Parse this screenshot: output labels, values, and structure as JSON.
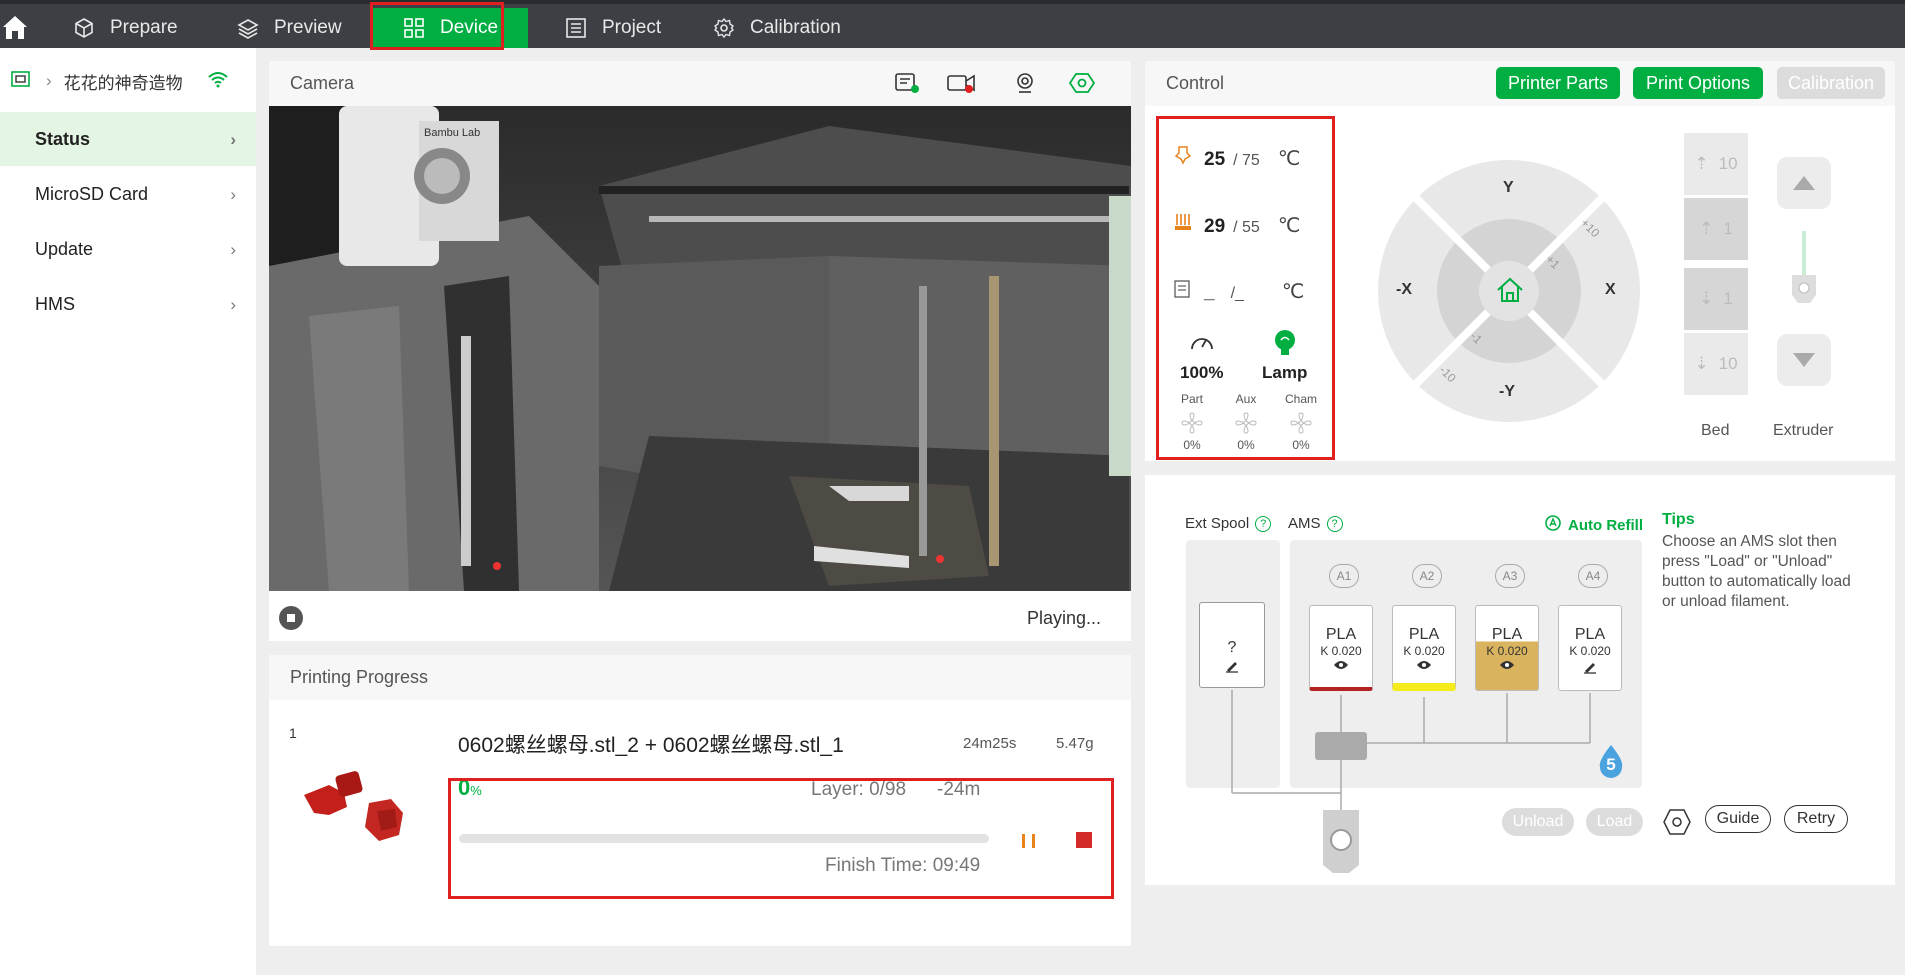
{
  "nav": {
    "tabs": [
      {
        "label": "Prepare",
        "icon": "cube-icon"
      },
      {
        "label": "Preview",
        "icon": "layers-icon"
      },
      {
        "label": "Device",
        "icon": "device-icon"
      },
      {
        "label": "Project",
        "icon": "list-icon"
      },
      {
        "label": "Calibration",
        "icon": "gear-icon"
      }
    ],
    "active_tab": "Device",
    "accent": "#00ae42"
  },
  "sidebar": {
    "device_name": "花花的神奇造物",
    "items": [
      {
        "label": "Status",
        "active": true
      },
      {
        "label": "MicroSD Card"
      },
      {
        "label": "Update"
      },
      {
        "label": "HMS"
      }
    ]
  },
  "camera": {
    "title": "Camera",
    "status": "Playing...",
    "logo": "Bambu Lab"
  },
  "progress": {
    "title": "Printing Progress",
    "plate": "1",
    "file_name": "0602螺丝螺母.stl_2 + 0602螺丝螺母.stl_1",
    "time": "24m25s",
    "weight": "5.47g",
    "percent": "0",
    "percent_unit": "%",
    "percent_value": 0,
    "layer": "Layer: 0/98",
    "remaining": "-24m",
    "finish_time": "Finish Time: 09:49"
  },
  "control": {
    "title": "Control",
    "buttons": {
      "printer_parts": "Printer Parts",
      "print_options": "Print Options",
      "calibration": "Calibration"
    },
    "nozzle": {
      "current": "25",
      "target": "/ 75",
      "unit": "℃"
    },
    "bed": {
      "current": "29",
      "target": "/ 55",
      "unit": "℃"
    },
    "chamber": {
      "current": "_",
      "target": "/_",
      "unit": "℃"
    },
    "speed": "100%",
    "lamp": "Lamp",
    "fans": [
      {
        "label": "Part",
        "value": "0%"
      },
      {
        "label": "Aux",
        "value": "0%"
      },
      {
        "label": "Cham",
        "value": "0%"
      }
    ],
    "jog": {
      "y": "Y",
      "neg_y": "-Y",
      "x": "X",
      "neg_x": "-X",
      "p10": "+10",
      "p1": "+1",
      "m1": "-1",
      "m10": "-10"
    },
    "bed_steps": [
      "10",
      "1",
      "1",
      "10"
    ],
    "bed_label": "Bed",
    "extruder_label": "Extruder"
  },
  "ams": {
    "ext_spool": "Ext Spool",
    "ams_label": "AMS",
    "auto_refill": "Auto Refill",
    "ext_slot": "?",
    "slots": [
      {
        "id": "A1",
        "material": "PLA",
        "k": "K 0.020",
        "color": "#b22222",
        "fill": "none"
      },
      {
        "id": "A2",
        "material": "PLA",
        "k": "K 0.020",
        "color": "#f5eb1b",
        "fill": "none"
      },
      {
        "id": "A3",
        "material": "PLA",
        "k": "K 0.020",
        "color": "#d9b35e",
        "fill": "#d9b35e"
      },
      {
        "id": "A4",
        "material": "PLA",
        "k": "K 0.020",
        "color": "#ffffff",
        "fill": "none"
      }
    ],
    "humidity": "5",
    "tips_title": "Tips",
    "tips_text": "Choose an AMS slot then press \"Load\" or \"Unload\" button to automatically load or unload filament.",
    "unload": "Unload",
    "load": "Load",
    "guide": "Guide",
    "retry": "Retry"
  }
}
